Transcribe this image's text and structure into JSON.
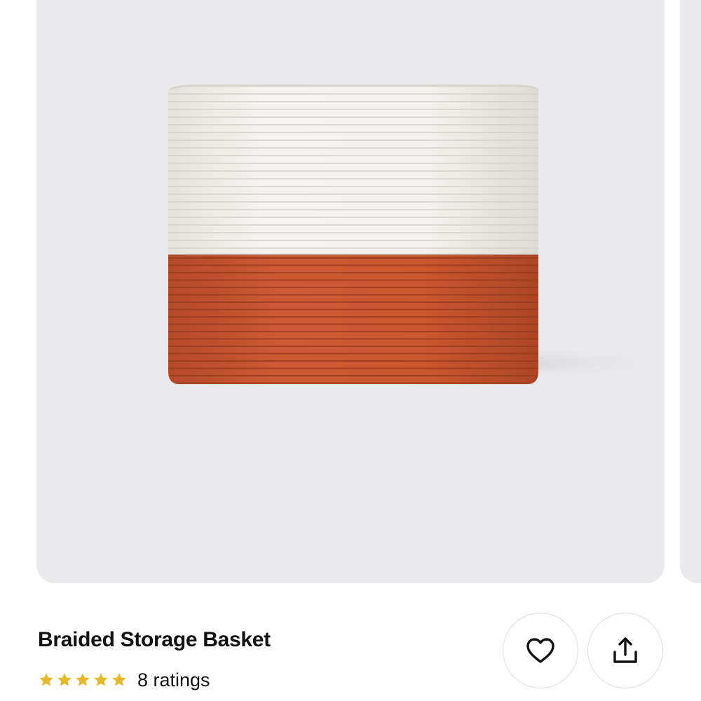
{
  "product": {
    "title": "Braided Storage Basket",
    "rating": {
      "stars": 5,
      "max_stars": 5,
      "count_label": "8 ratings"
    },
    "image": {
      "subject": "basket-photo",
      "colors": {
        "background": "#ebebed",
        "upper_band": "#f2f0ec",
        "lower_band": "#c5532f"
      }
    }
  },
  "actions": {
    "favorite_icon": "heart-icon",
    "share_icon": "share-upload-icon"
  },
  "colors": {
    "star": "#e8b92a",
    "text": "#111111",
    "button_border": "#dcdcdc"
  }
}
